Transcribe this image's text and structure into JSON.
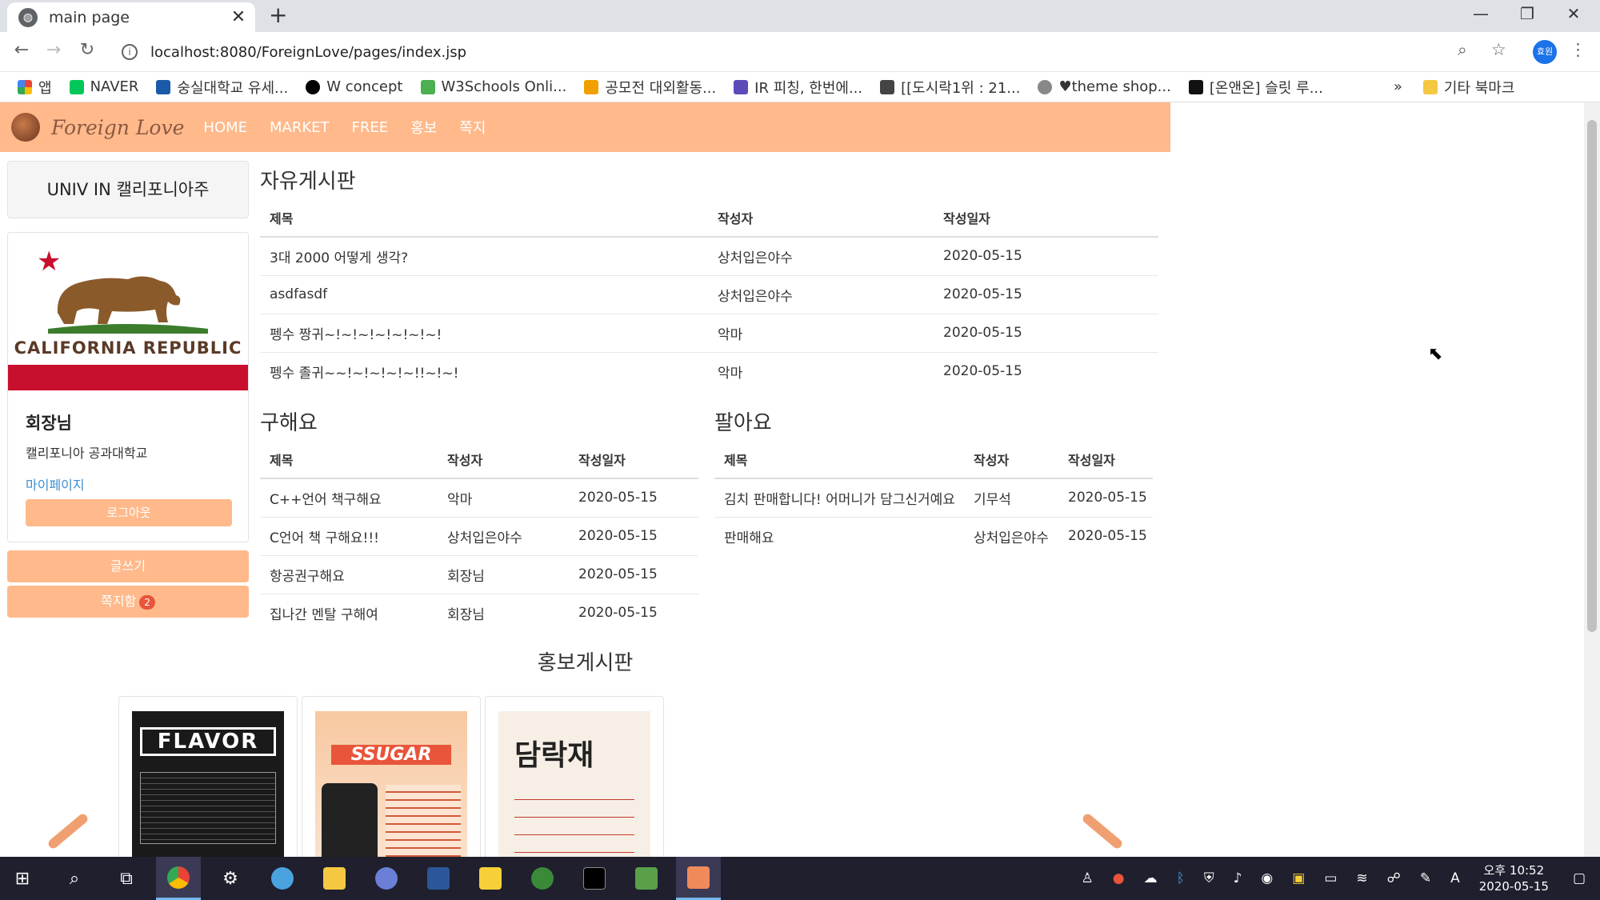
{
  "browser": {
    "tab_title": "main page",
    "url": "localhost:8080/ForeignLove/pages/index.jsp",
    "bookmarks": [
      {
        "label": "앱",
        "color": "#ea4335"
      },
      {
        "label": "NAVER",
        "color": "#03c75a"
      },
      {
        "label": "숭실대학교 유세...",
        "color": "#1a5aa8"
      },
      {
        "label": "W concept",
        "color": "#000000"
      },
      {
        "label": "W3Schools Onli...",
        "color": "#4caf50"
      },
      {
        "label": "공모전 대외활동...",
        "color": "#f0a000"
      },
      {
        "label": "IR 피칭, 한번에...",
        "color": "#5c4bb8"
      },
      {
        "label": "[[도시락1위 : 21...",
        "color": "#444444"
      },
      {
        "label": "♥theme shop...",
        "color": "#666666"
      },
      {
        "label": "[온앤온] 슬릿 루...",
        "color": "#111111"
      }
    ],
    "bookmarks_more": "»",
    "other_bookmarks": "기타 북마크",
    "profile_label": "효원"
  },
  "nav": {
    "brand": "Foreign Love",
    "items": [
      "HOME",
      "MARKET",
      "FREE",
      "홍보",
      "쪽지"
    ]
  },
  "sidebar": {
    "univ_label": "UNIV IN 캘리포니아주",
    "flag_text": "CALIFORNIA  REPUBLIC",
    "user_name": "회장님",
    "school": "캘리포니아 공과대학교",
    "mypage": "마이페이지",
    "logout": "로그아웃",
    "write": "글쓰기",
    "inbox": "쪽지함",
    "inbox_count": "2"
  },
  "free_board": {
    "title": "자유게시판",
    "headers": [
      "제목",
      "작성자",
      "작성일자"
    ],
    "rows": [
      [
        "3대 2000 어떻게 생각?",
        "상처입은야수",
        "2020-05-15"
      ],
      [
        "asdfasdf",
        "상처입은야수",
        "2020-05-15"
      ],
      [
        "펭수 짱귀~!~!~!~!~!~!~!",
        "악마",
        "2020-05-15"
      ],
      [
        "펭수 졸귀~~!~!~!~!~!!~!~!",
        "악마",
        "2020-05-15"
      ]
    ]
  },
  "buy_board": {
    "title": "구해요",
    "headers": [
      "제목",
      "작성자",
      "작성일자"
    ],
    "rows": [
      [
        "C++언어 책구해요",
        "악마",
        "2020-05-15"
      ],
      [
        "C언어 책 구해요!!!",
        "상처입은야수",
        "2020-05-15"
      ],
      [
        "항공권구해요",
        "회장님",
        "2020-05-15"
      ],
      [
        "집나간 멘탈 구해여",
        "회장님",
        "2020-05-15"
      ]
    ]
  },
  "sell_board": {
    "title": "팔아요",
    "headers": [
      "제목",
      "작성자",
      "작성일자"
    ],
    "rows": [
      [
        "김치 판매합니다! 어머니가 담그신거예요",
        "기무석",
        "2020-05-15"
      ],
      [
        "판매해요",
        "상처입은야수",
        "2020-05-15"
      ]
    ]
  },
  "promo_board": {
    "title": "홍보게시판",
    "posters": [
      "FLAVOR",
      "SSUGAR",
      "담락재"
    ]
  },
  "taskbar": {
    "time": "오후 10:52",
    "date": "2020-05-15",
    "ime": "A"
  }
}
